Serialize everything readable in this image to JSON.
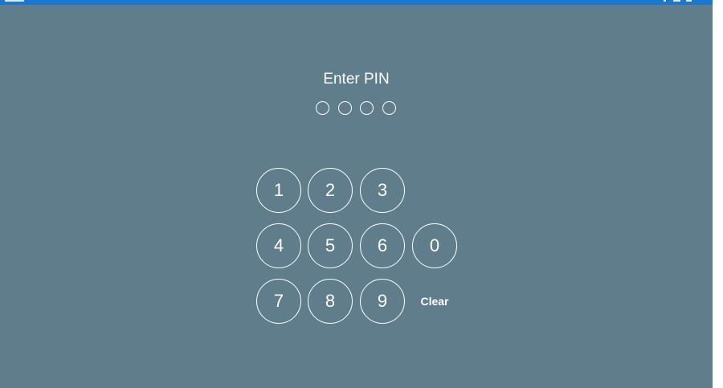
{
  "title": "Enter PIN",
  "pin": {
    "length": 4,
    "filled": 0
  },
  "keypad": {
    "keys": [
      "1",
      "2",
      "3",
      "4",
      "5",
      "6",
      "0",
      "7",
      "8",
      "9"
    ],
    "clear_label": "Clear"
  },
  "colors": {
    "background": "#607d8b",
    "status_bar": "#1976d2",
    "foreground": "#ffffff"
  }
}
